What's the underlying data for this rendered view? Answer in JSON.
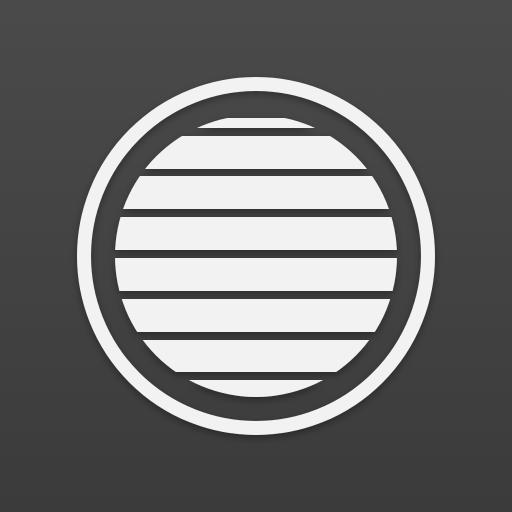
{
  "icon": {
    "name": "striped-globe-app-icon",
    "colors": {
      "background": "#474747",
      "emblem": "#f2f2f2"
    }
  }
}
